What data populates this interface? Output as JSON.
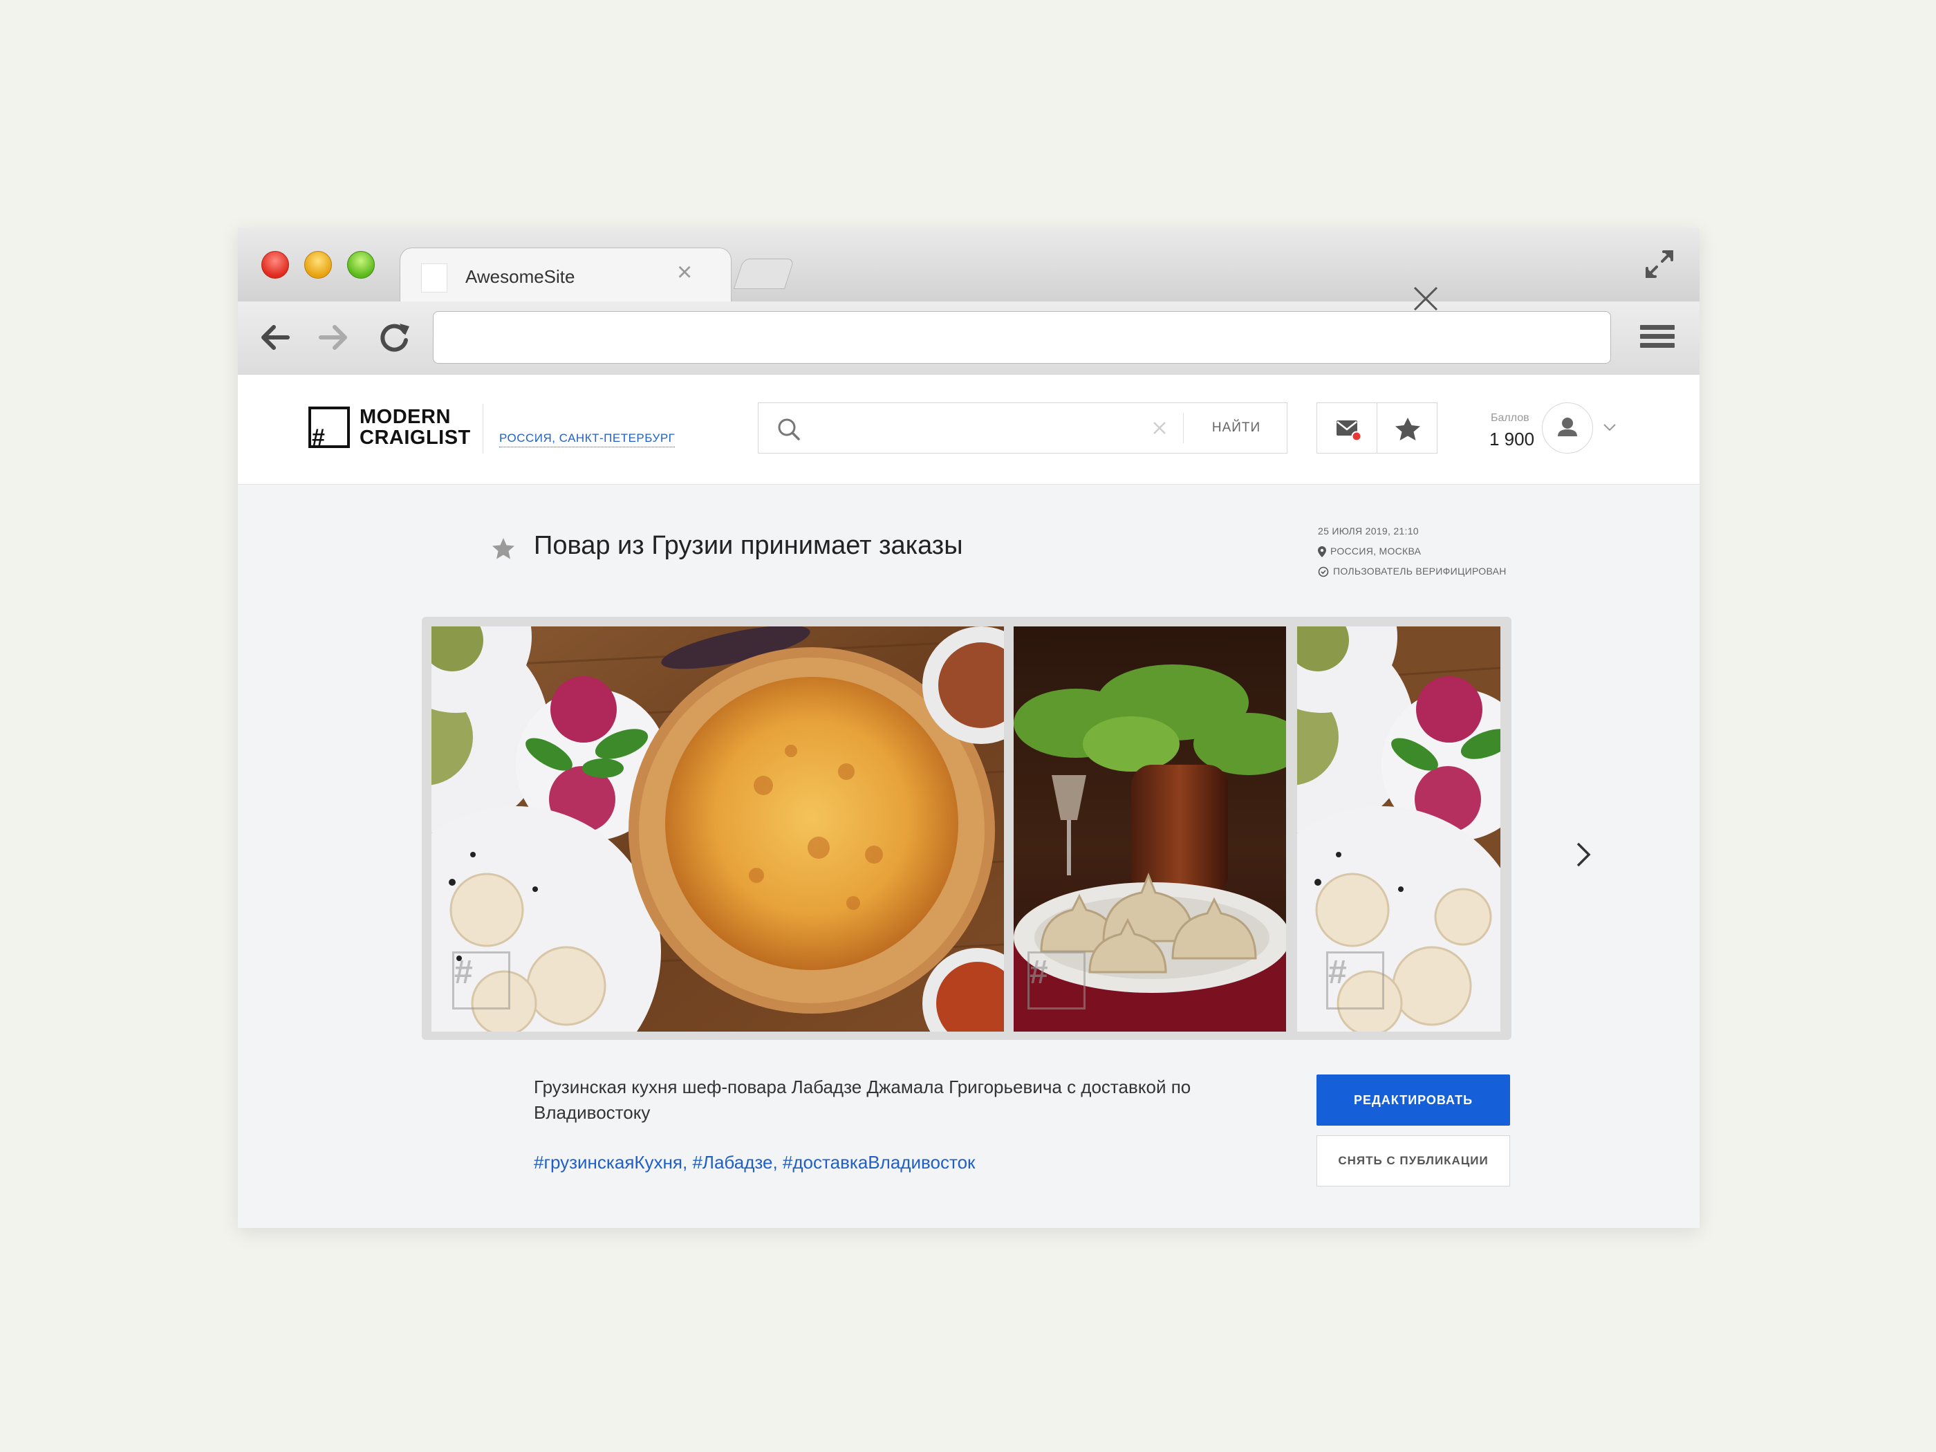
{
  "browser": {
    "tab_title": "AwesomeSite",
    "address": ""
  },
  "site": {
    "logo_line1": "MODERN",
    "logo_line2": "CRAIGLIST",
    "logo_mark": "#",
    "location": "РОССИЯ, САНКТ-ПЕТЕРБУРГ",
    "search": {
      "placeholder": "",
      "button": "НАЙТИ"
    },
    "score": {
      "label": "Баллов",
      "value": "1 900"
    },
    "colors": {
      "accent": "#1560d8",
      "link": "#1f5fc7",
      "notification": "#e53935"
    }
  },
  "post": {
    "title": "Повар из Грузии принимает заказы",
    "meta": {
      "date": "25 ИЮЛЯ 2019, 21:10",
      "location": "РОССИЯ, МОСКВА",
      "verified": "ПОЛЬЗОВАТЕЛЬ ВЕРИФИЦИРОВАН"
    },
    "description": "Грузинская кухня шеф-повара Лабадзе Джамала Григорьевича с доставкой по Владивостоку",
    "tags": [
      "#грузинскаяКухня,",
      "#Лабадзе,",
      "#доставкаВладивосток"
    ],
    "actions": {
      "edit": "РЕДАКТИРОВАТЬ",
      "unpublish": "СНЯТЬ С ПУБЛИКАЦИИ"
    },
    "gallery": {
      "watermark": "#",
      "photos": [
        "khachapuri-pkhali-khinkali",
        "khinkali-plate",
        "pkhali-khinkali"
      ]
    }
  }
}
